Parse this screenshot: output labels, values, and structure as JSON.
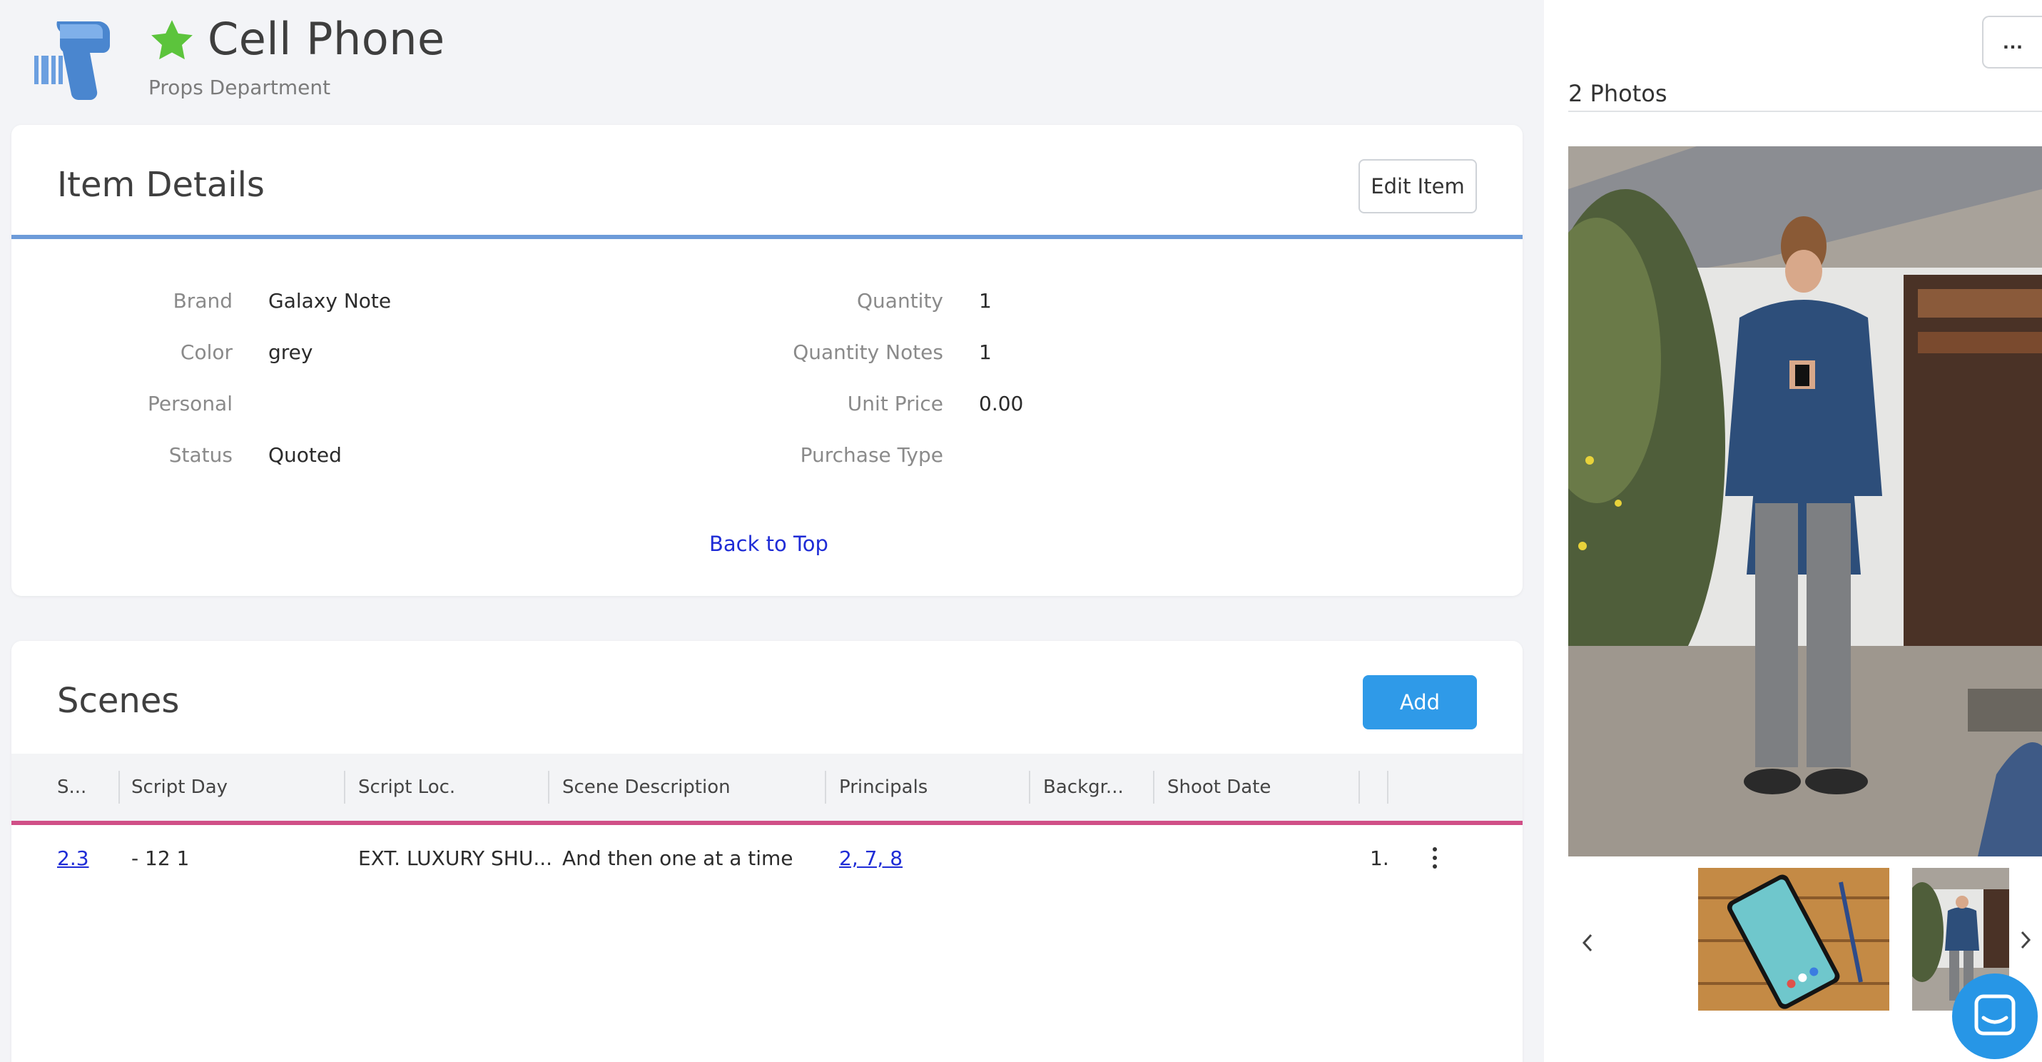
{
  "header": {
    "title": "Cell Phone",
    "subtitle": "Props Department"
  },
  "details": {
    "title": "Item Details",
    "edit_label": "Edit Item",
    "left_fields": [
      {
        "label": "Brand",
        "value": "Galaxy Note"
      },
      {
        "label": "Color",
        "value": "grey"
      },
      {
        "label": "Personal",
        "value": ""
      },
      {
        "label": "Status",
        "value": "Quoted"
      }
    ],
    "right_fields": [
      {
        "label": "Quantity",
        "value": "1"
      },
      {
        "label": "Quantity Notes",
        "value": "1"
      },
      {
        "label": "Unit Price",
        "value": "0.00"
      },
      {
        "label": "Purchase Type",
        "value": ""
      }
    ],
    "back_to_top": "Back to Top",
    "accent_color": "#6d9bd9"
  },
  "scenes": {
    "title": "Scenes",
    "add_label": "Add",
    "columns": [
      "S...",
      "Script Day",
      "Script Loc.",
      "Scene Description",
      "Principals",
      "Backgr...",
      "Shoot Date",
      "",
      ""
    ],
    "rows": [
      {
        "scene": "2.3",
        "script_day": "- 12 1",
        "script_loc": "EXT. LUXURY SHU...",
        "description": "And then one at a time",
        "principals": "2, 7, 8",
        "background": "",
        "shoot_date": "",
        "extra": "1."
      }
    ],
    "accent_color": "#d04f87"
  },
  "photos": {
    "more_label": "…",
    "title": "2 Photos",
    "prev_icon": "chevron-left-icon",
    "next_icon": "chevron-right-icon"
  },
  "colors": {
    "primary": "#2f9ae8",
    "link": "#1f2cd6",
    "star": "#5cc43c"
  }
}
